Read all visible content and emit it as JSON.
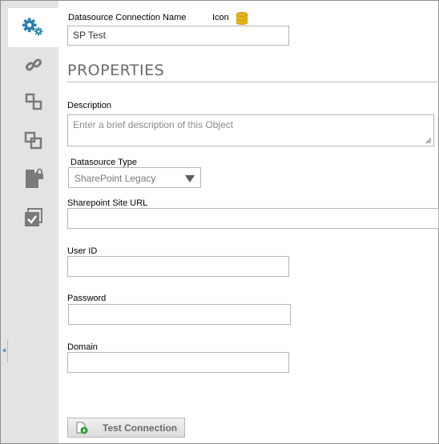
{
  "form": {
    "name_label": "Datasource Connection Name",
    "name_value": "SP Test",
    "icon_label": "Icon",
    "section_title": "PROPERTIES",
    "description_label": "Description",
    "description_placeholder": "Enter a brief description of this Object",
    "type_label": "Datasource Type",
    "type_value": "SharePoint Legacy",
    "site_url_label": "Sharepoint Site URL",
    "site_url_value": "",
    "user_id_label": "User ID",
    "user_id_value": "",
    "password_label": "Password",
    "password_value": "",
    "domain_label": "Domain",
    "domain_value": "",
    "test_button_label": "Test Connection"
  },
  "sidebar": {
    "items": [
      {
        "icon": "settings-gears-icon",
        "active": true
      },
      {
        "icon": "link-icon",
        "active": false
      },
      {
        "icon": "relationship-icon",
        "active": false
      },
      {
        "icon": "copy-icon",
        "active": false
      },
      {
        "icon": "locked-document-icon",
        "active": false
      },
      {
        "icon": "checklist-icon",
        "active": false
      }
    ]
  },
  "colors": {
    "accent_blue": "#2b7fb0",
    "icon_gray": "#7a7a7a",
    "database_gold": "#e5b21c",
    "sidebar_bg": "#e3e3e3"
  }
}
